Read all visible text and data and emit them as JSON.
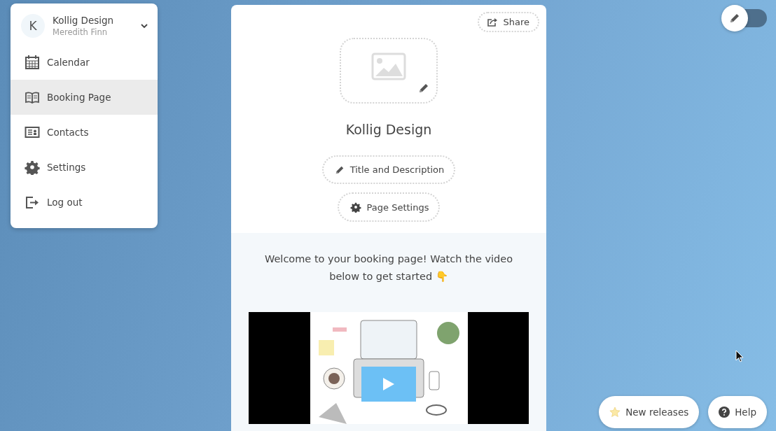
{
  "account": {
    "initial": "K",
    "name": "Kollig Design",
    "user": "Meredith Finn"
  },
  "sidebar": {
    "items": [
      {
        "label": "Calendar",
        "selected": false
      },
      {
        "label": "Booking Page",
        "selected": true
      },
      {
        "label": "Contacts",
        "selected": false
      },
      {
        "label": "Settings",
        "selected": false
      },
      {
        "label": "Log out",
        "selected": false
      }
    ]
  },
  "page": {
    "share": "Share",
    "title": "Kollig Design",
    "buttons": [
      "Title and Description",
      "Page Settings"
    ],
    "welcome": "Welcome to your booking page! Watch the video below to get started 👇"
  },
  "edit_toggle": {
    "on": false
  },
  "footer_buttons": [
    "New releases",
    "Help"
  ]
}
